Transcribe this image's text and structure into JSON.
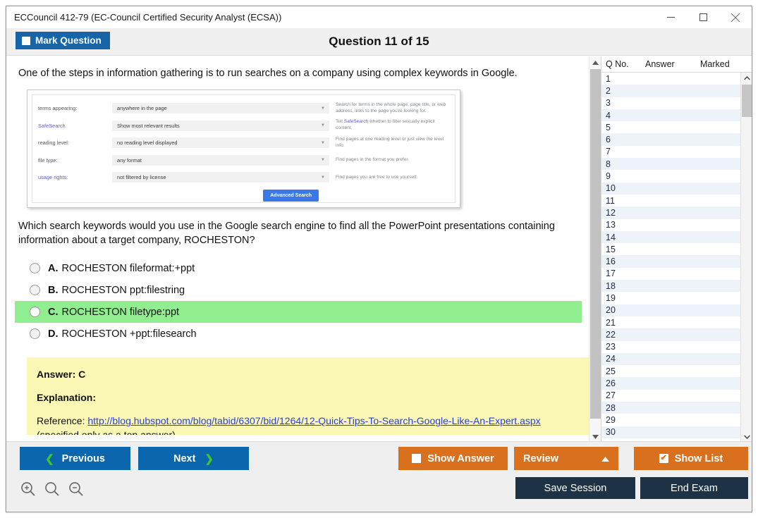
{
  "window": {
    "title": "ECCouncil 412-79 (EC-Council Certified Security Analyst (ECSA))",
    "minimize_label": "─",
    "maximize_label": "□",
    "close_label": "✕"
  },
  "header": {
    "mark_question_label": "Mark Question",
    "question_counter": "Question 11 of 15"
  },
  "question": {
    "stem": "One of the steps in information gathering is to run searches on a company using complex keywords in Google.",
    "text": "Which search keywords would you use in the Google search engine to find all the PowerPoint presentations containing information about a target company, ROCHESTON?",
    "options": [
      {
        "letter": "A.",
        "text": "ROCHESTON fileformat:+ppt",
        "correct": false
      },
      {
        "letter": "B.",
        "text": "ROCHESTON ppt:filestring",
        "correct": false
      },
      {
        "letter": "C.",
        "text": "ROCHESTON filetype:ppt",
        "correct": true
      },
      {
        "letter": "D.",
        "text": "ROCHESTON +ppt:filesearch",
        "correct": false
      }
    ]
  },
  "embedded_image": {
    "rows": [
      {
        "label": "terms appearing:",
        "label_is_link": false,
        "value": "anywhere in the page",
        "hint_pre": "Search for terms in the whole page, page title, or web address, links to the page you're looking for.",
        "hint_link": "",
        "hint_post": ""
      },
      {
        "label": "SafeSearch",
        "label_is_link": true,
        "value": "Show most relevant results",
        "hint_pre": "Tell ",
        "hint_link": "SafeSearch",
        "hint_post": " whether to filter sexually explicit content."
      },
      {
        "label": "reading level:",
        "label_is_link": false,
        "value": "no reading level displayed",
        "hint_pre": "Find pages at one reading level or just view the level info.",
        "hint_link": "",
        "hint_post": ""
      },
      {
        "label": "file type:",
        "label_is_link": false,
        "value": "any format",
        "hint_pre": "Find pages in the format you prefer.",
        "hint_link": "",
        "hint_post": ""
      },
      {
        "label": "usage rights:",
        "label_is_link": true,
        "value": "not filtered by license",
        "hint_pre": "Find pages you are free to use yourself.",
        "hint_link": "",
        "hint_post": ""
      }
    ],
    "submit_label": "Advanced Search"
  },
  "answer_panel": {
    "answer_label": "Answer: C",
    "explanation_label": "Explanation:",
    "reference_prefix": "Reference: ",
    "reference_url": "http://blog.hubspot.com/blog/tabid/6307/bid/1264/12-Quick-Tips-To-Search-Google-Like-An-Expert.aspx",
    "reference_note": "(specified only as a top answer)"
  },
  "question_list": {
    "columns": [
      "Q No.",
      "Answer",
      "Marked"
    ],
    "rows": [
      {
        "no": "1",
        "answer": "",
        "marked": ""
      },
      {
        "no": "2",
        "answer": "",
        "marked": ""
      },
      {
        "no": "3",
        "answer": "",
        "marked": ""
      },
      {
        "no": "4",
        "answer": "",
        "marked": ""
      },
      {
        "no": "5",
        "answer": "",
        "marked": ""
      },
      {
        "no": "6",
        "answer": "",
        "marked": ""
      },
      {
        "no": "7",
        "answer": "",
        "marked": ""
      },
      {
        "no": "8",
        "answer": "",
        "marked": ""
      },
      {
        "no": "9",
        "answer": "",
        "marked": ""
      },
      {
        "no": "10",
        "answer": "",
        "marked": ""
      },
      {
        "no": "11",
        "answer": "",
        "marked": ""
      },
      {
        "no": "12",
        "answer": "",
        "marked": ""
      },
      {
        "no": "13",
        "answer": "",
        "marked": ""
      },
      {
        "no": "14",
        "answer": "",
        "marked": ""
      },
      {
        "no": "15",
        "answer": "",
        "marked": ""
      },
      {
        "no": "16",
        "answer": "",
        "marked": ""
      },
      {
        "no": "17",
        "answer": "",
        "marked": ""
      },
      {
        "no": "18",
        "answer": "",
        "marked": ""
      },
      {
        "no": "19",
        "answer": "",
        "marked": ""
      },
      {
        "no": "20",
        "answer": "",
        "marked": ""
      },
      {
        "no": "21",
        "answer": "",
        "marked": ""
      },
      {
        "no": "22",
        "answer": "",
        "marked": ""
      },
      {
        "no": "23",
        "answer": "",
        "marked": ""
      },
      {
        "no": "24",
        "answer": "",
        "marked": ""
      },
      {
        "no": "25",
        "answer": "",
        "marked": ""
      },
      {
        "no": "26",
        "answer": "",
        "marked": ""
      },
      {
        "no": "27",
        "answer": "",
        "marked": ""
      },
      {
        "no": "28",
        "answer": "",
        "marked": ""
      },
      {
        "no": "29",
        "answer": "",
        "marked": ""
      },
      {
        "no": "30",
        "answer": "",
        "marked": ""
      }
    ]
  },
  "footer": {
    "previous_label": "Previous",
    "next_label": "Next",
    "show_answer_label": "Show Answer",
    "show_answer_checked": false,
    "review_label": "Review",
    "show_list_label": "Show List",
    "show_list_checked": true,
    "save_session_label": "Save Session",
    "end_exam_label": "End Exam",
    "checkmark": "✔"
  },
  "colors": {
    "primary_blue": "#0b66ae",
    "title_blue": "#1565a8",
    "orange": "#d9701e",
    "navy": "#1d3245",
    "correct_green": "#90ee90",
    "answer_yellow": "#fbf7b5",
    "chevron_green": "#3ec72a",
    "link_blue": "#2b3ee0"
  }
}
